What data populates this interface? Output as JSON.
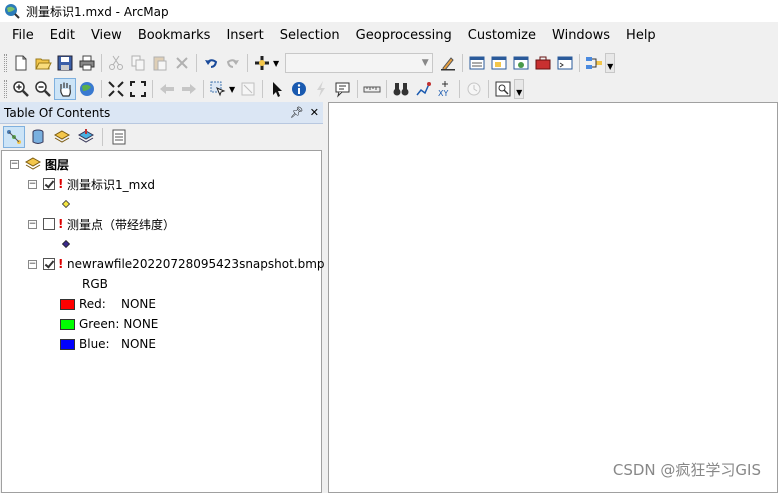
{
  "window": {
    "title": "测量标识1.mxd - ArcMap"
  },
  "menu": [
    "File",
    "Edit",
    "View",
    "Bookmarks",
    "Insert",
    "Selection",
    "Geoprocessing",
    "Customize",
    "Windows",
    "Help"
  ],
  "toc": {
    "title": "Table Of Contents",
    "root_label": "图层",
    "layers": [
      {
        "name": "测量标识1_mxd",
        "checked": true,
        "symbol_color": "#f5e642"
      },
      {
        "name": "测量点（带经纬度）",
        "checked": false,
        "symbol_color": "#3a2a8a"
      },
      {
        "name": "newrawfile20220728095423snapshot.bmp",
        "checked": true,
        "sublabel": "RGB",
        "bands": [
          {
            "label": "Red:",
            "value": "NONE",
            "color": "#ff0000"
          },
          {
            "label": "Green:",
            "value": "NONE",
            "color": "#00ff00"
          },
          {
            "label": "Blue:",
            "value": "NONE",
            "color": "#0000ff"
          }
        ]
      }
    ]
  },
  "watermark": "CSDN @疯狂学习GIS",
  "colors": {
    "title_bg": "#ffffff",
    "toc_header_bg": "#dbe6f4",
    "map_bg": "#ffffff"
  }
}
